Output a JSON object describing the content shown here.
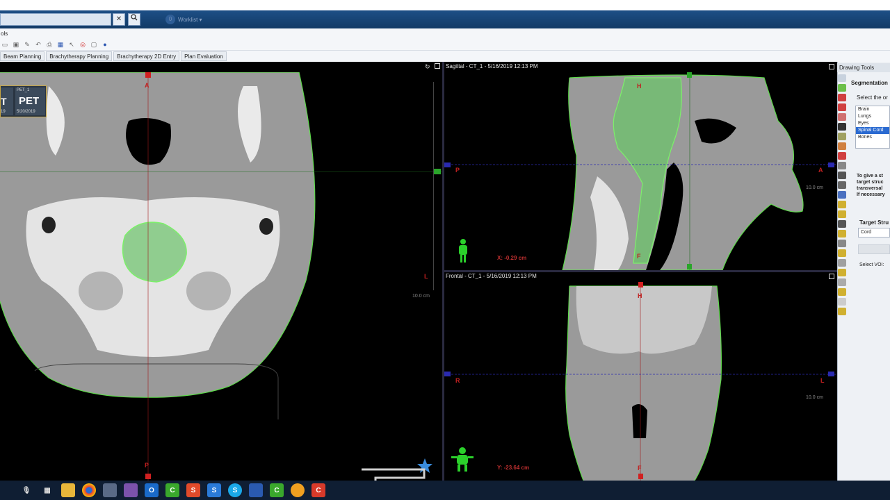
{
  "app": {
    "search_placeholder": "",
    "worklist_label": "Worklist ▾",
    "menu_text": "ols"
  },
  "tabs": [
    "Beam Planning",
    "Brachytherapy Planning",
    "Brachytherapy 2D Entry",
    "Plan Evaluation"
  ],
  "axial": {
    "marker_top": "A",
    "marker_bottom": "P",
    "marker_right": "L",
    "scale_label": "10.0 cm",
    "thumb_pet_label": "PET_1",
    "thumb_pet_text": "PET",
    "thumb_ct_text": "T",
    "thumb_date": "5/20/2019",
    "thumb_date2": "19"
  },
  "sagittal": {
    "title": "Sagittal - CT_1 - 5/16/2019 12:13 PM",
    "marker_top": "H",
    "marker_bottom": "F",
    "marker_left": "P",
    "marker_right": "A",
    "scale_label": "10.0 cm",
    "coord_label": "X: -0.29 cm"
  },
  "frontal": {
    "title": "Frontal - CT_1 - 5/16/2019 12:13 PM",
    "marker_top": "H",
    "marker_bottom": "F",
    "marker_left": "R",
    "marker_right": "L",
    "scale_label": "10.0 cm",
    "coord_label": "Y: -23.64 cm"
  },
  "drawing_tools": {
    "panel_title": "Drawing Tools",
    "section_title": "Segmentation",
    "select_text": "Select the or",
    "organs": [
      "Brain",
      "Lungs",
      "Eyes",
      "Spinal Cord",
      "Bones"
    ],
    "selected_organ": "Spinal Cord",
    "instructions": [
      "To give a st",
      "target struc",
      "transversal",
      "If necessary"
    ],
    "target_struct_label": "Target Stru",
    "target_struct_value": "Cord",
    "select_voi_label": "Select VOI:"
  },
  "colors": {
    "contour_green": "#5dd84a",
    "titlebar_blue": "#123a66",
    "selection_blue": "#2a6ad1",
    "marker_red": "#c02020"
  },
  "taskbar_icons": [
    "mic-icon",
    "taskview-icon",
    "file-explorer-icon",
    "chrome-icon",
    "app-icon",
    "visual-studio-icon",
    "outlook-icon",
    "camtasia-green-icon",
    "slides-icon",
    "edge-s-icon",
    "skype-icon",
    "app2-icon",
    "camtasia-icon",
    "paint-icon",
    "camtasia-red-icon"
  ]
}
